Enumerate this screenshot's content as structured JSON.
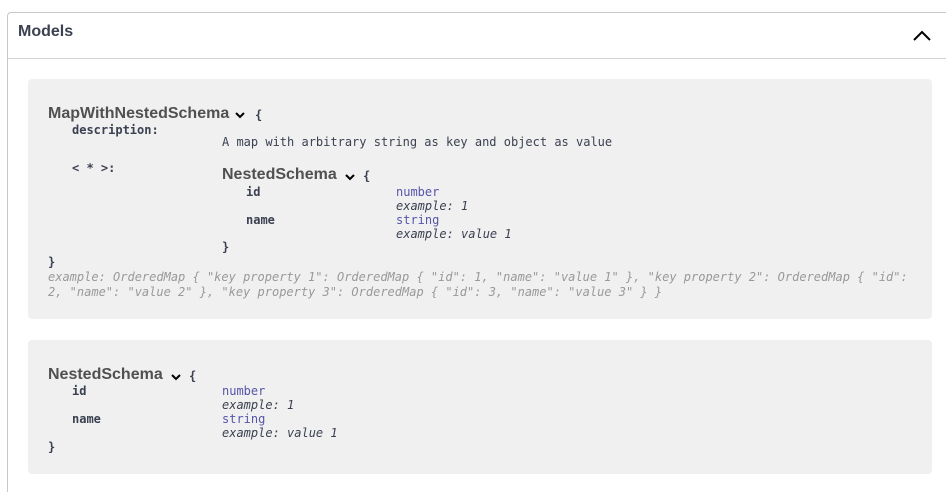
{
  "section": {
    "title": "Models"
  },
  "models": [
    {
      "name": "MapWithNestedSchema",
      "open_brace": "{",
      "close_brace": "}",
      "description_label": "description:",
      "description": "A map with arbitrary string as key and object as value",
      "additional_props_label": "< * >:",
      "nested": {
        "name": "NestedSchema",
        "open_brace": "{",
        "close_brace": "}",
        "properties": [
          {
            "name": "id",
            "type": "number",
            "example": "example: 1"
          },
          {
            "name": "name",
            "type": "string",
            "example": "example: value 1"
          }
        ]
      },
      "example": "example: OrderedMap { \"key property 1\": OrderedMap { \"id\": 1, \"name\": \"value 1\" }, \"key property 2\": OrderedMap { \"id\": 2, \"name\": \"value 2\" }, \"key property 3\": OrderedMap { \"id\": 3, \"name\": \"value 3\" } }"
    },
    {
      "name": "NestedSchema",
      "open_brace": "{",
      "close_brace": "}",
      "properties": [
        {
          "name": "id",
          "type": "number",
          "example": "example: 1"
        },
        {
          "name": "name",
          "type": "string",
          "example": "example: value 1"
        }
      ]
    }
  ],
  "icons": {
    "collapse": "chevron-up-icon",
    "expand": "chevron-down-icon"
  }
}
